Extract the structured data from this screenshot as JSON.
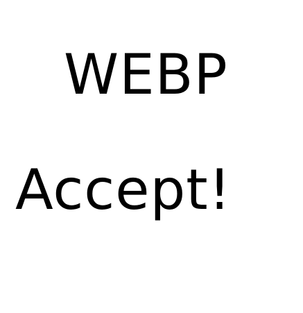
{
  "text": {
    "line1": "WEBP",
    "line2": "Accept!"
  },
  "colors": {
    "background": "#ffffff",
    "text": "#000000"
  }
}
